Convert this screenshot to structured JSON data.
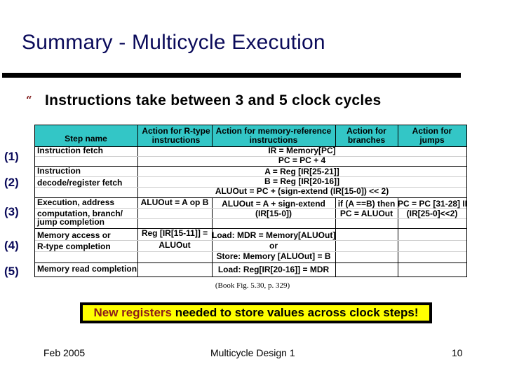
{
  "slide": {
    "title": "Summary - Multicycle Execution",
    "bullet_icon": "quote-bullet-icon",
    "bullet_glyph": "“",
    "bullet_text": "Instructions take between 3 and 5 clock cycles"
  },
  "steps": [
    "(1)",
    "(2)",
    "(3)",
    "(4)",
    "(5)"
  ],
  "table": {
    "headers": {
      "step_name": "Step name",
      "rtype": [
        "Action for R-type",
        "instructions"
      ],
      "memref": [
        "Action for memory-reference",
        "instructions"
      ],
      "branches": [
        "Action for",
        "branches"
      ],
      "jumps": [
        "Action for",
        "jumps"
      ]
    },
    "rows": [
      {
        "step_name": [
          "Instruction fetch"
        ],
        "shared": [
          "IR = Memory[PC]",
          "PC = PC + 4"
        ]
      },
      {
        "step_name": [
          "Instruction",
          "decode/register fetch"
        ],
        "shared": [
          "A = Reg [IR[25-21]]",
          "B = Reg [IR[20-16]]",
          "ALUOut = PC + (sign-extend (IR[15-0]) << 2)"
        ]
      },
      {
        "step_name": [
          "Execution, address",
          "computation, branch/",
          "jump completion"
        ],
        "rtype": [
          "ALUOut = A op B"
        ],
        "memref": [
          "ALUOut = A + sign-extend",
          "(IR[15-0])"
        ],
        "branches": [
          "if (A ==B) then",
          "PC = ALUOut"
        ],
        "jumps": [
          "PC = PC [31-28] II",
          "(IR[25-0]<<2)"
        ]
      },
      {
        "step_name": [
          "Memory access or",
          "R-type completion"
        ],
        "rtype": [
          "Reg [IR[15-11]] =",
          "ALUOut"
        ],
        "memref": [
          "Load: MDR = Memory[ALUOut]",
          "or",
          "Store: Memory [ALUOut] = B"
        ]
      },
      {
        "step_name": [
          "Memory read completion"
        ],
        "memref": [
          "Load: Reg[IR[20-16]] = MDR"
        ]
      }
    ]
  },
  "reference": "(Book Fig. 5.30, p. 329)",
  "callout": {
    "highlight": "New registers",
    "rest": " needed to store values across clock steps!",
    "highlight_color": "#8b1a1a",
    "background": "#ffff00"
  },
  "footer": {
    "date": "Feb 2005",
    "center": "Multicycle Design 1",
    "page": "10"
  },
  "colors": {
    "title": "#0a0a5a",
    "header_bg": "#33c6c6",
    "bullet": "#7a1010"
  }
}
